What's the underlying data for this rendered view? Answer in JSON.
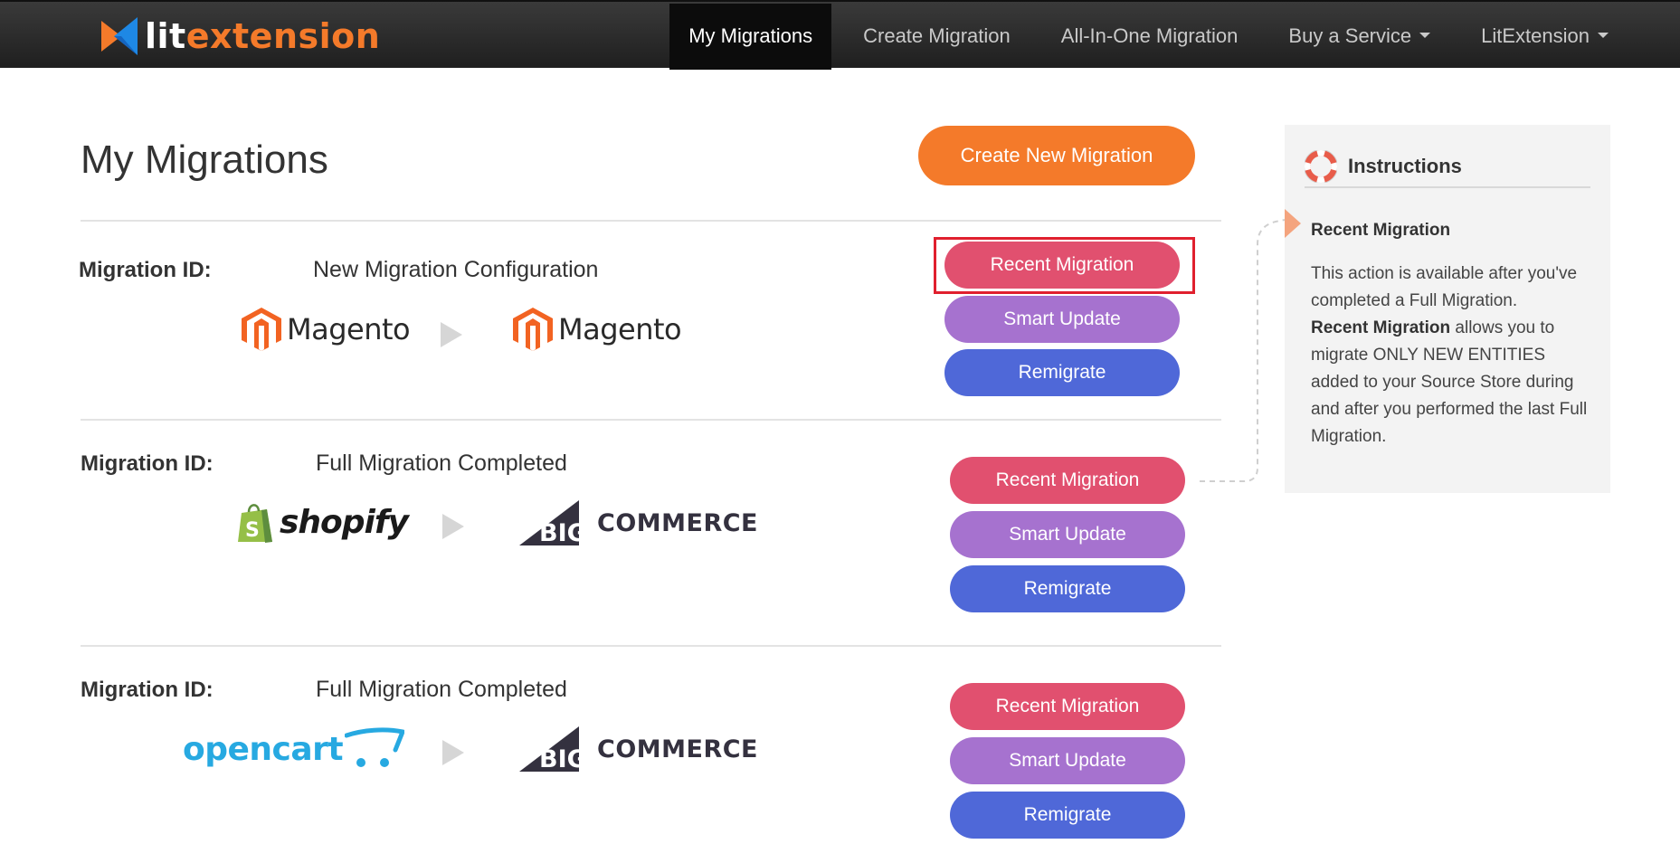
{
  "navbar": {
    "logo": {
      "part1": "lit",
      "part2": "extension"
    },
    "items": [
      {
        "label": "My Migrations",
        "active": true,
        "dropdown": false
      },
      {
        "label": "Create Migration",
        "active": false,
        "dropdown": false
      },
      {
        "label": "All-In-One Migration",
        "active": false,
        "dropdown": false
      },
      {
        "label": "Buy a Service",
        "active": false,
        "dropdown": true
      },
      {
        "label": "LitExtension",
        "active": false,
        "dropdown": true
      }
    ]
  },
  "main": {
    "title": "My Migrations",
    "create_button": "Create New Migration",
    "migrations": [
      {
        "label": "Migration ID:",
        "status": "New Migration Configuration",
        "source": "Magento",
        "target": "Magento",
        "buttons": {
          "recent": "Recent Migration",
          "smart": "Smart Update",
          "remigrate": "Remigrate"
        }
      },
      {
        "label": "Migration ID:",
        "status": "Full Migration Completed",
        "source": "shopify",
        "target": {
          "big": "BIG",
          "rest": "COMMERCE"
        },
        "buttons": {
          "recent": "Recent Migration",
          "smart": "Smart Update",
          "remigrate": "Remigrate"
        }
      },
      {
        "label": "Migration ID:",
        "status": "Full Migration Completed",
        "source": "opencart",
        "target": {
          "big": "BIG",
          "rest": "COMMERCE"
        },
        "buttons": {
          "recent": "Recent Migration",
          "smart": "Smart Update",
          "remigrate": "Remigrate"
        }
      }
    ]
  },
  "instructions": {
    "title": "Instructions",
    "subtitle": "Recent Migration",
    "body": {
      "p1": "This action is available after you've completed a Full Migration.",
      "bold": "Recent Migration",
      "p2": " allows you to migrate ONLY NEW ENTITIES added to your Source Store during and after you performed the last Full Migration."
    }
  },
  "colors": {
    "orange": "#f47a2a",
    "recent": "#e1506f",
    "smart": "#a672cf",
    "remigrate": "#4f68d8",
    "highlight": "#e0202e"
  }
}
